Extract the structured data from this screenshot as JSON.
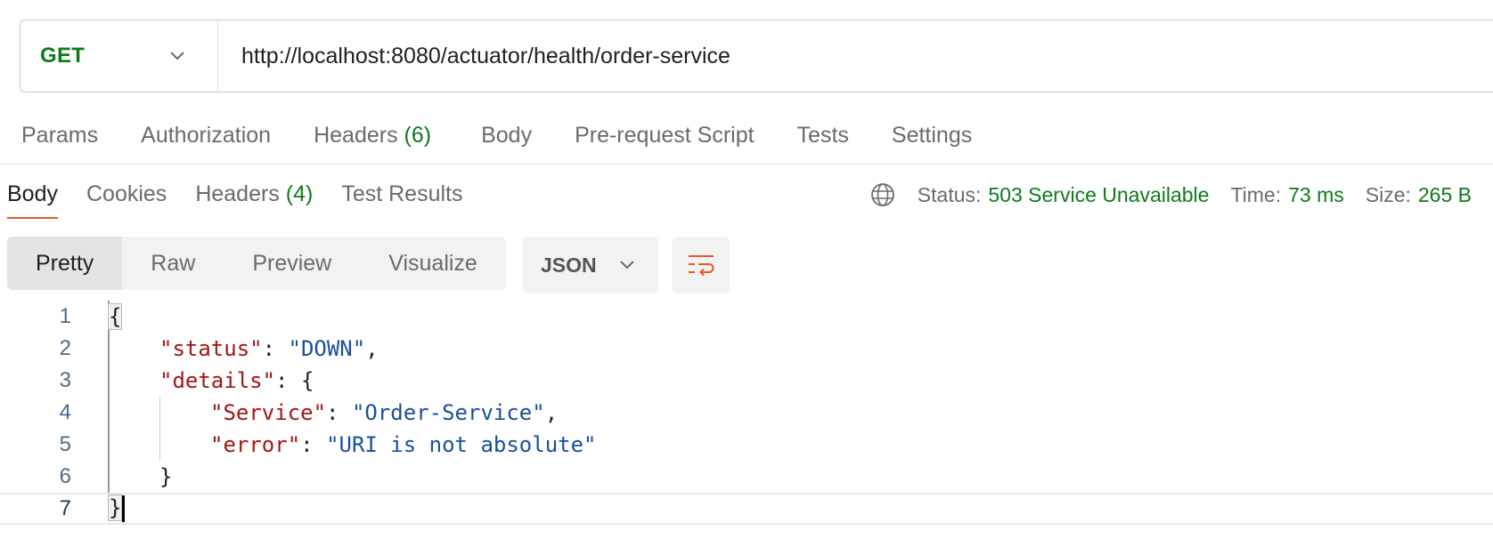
{
  "request": {
    "method": "GET",
    "url": "http://localhost:8080/actuator/health/order-service"
  },
  "request_tabs": {
    "params": "Params",
    "authorization": "Authorization",
    "headers_label": "Headers",
    "headers_count": "(6)",
    "body": "Body",
    "prerequest": "Pre-request Script",
    "tests": "Tests",
    "settings": "Settings"
  },
  "response_tabs": {
    "body": "Body",
    "cookies": "Cookies",
    "headers_label": "Headers",
    "headers_count": "(4)",
    "test_results": "Test Results"
  },
  "status": {
    "status_label": "Status:",
    "status_value": "503 Service Unavailable",
    "time_label": "Time:",
    "time_value": "73 ms",
    "size_label": "Size:",
    "size_value": "265 B",
    "icon": "globe-icon"
  },
  "view": {
    "modes": [
      "Pretty",
      "Raw",
      "Preview",
      "Visualize"
    ],
    "active_mode": "Pretty",
    "format": "JSON",
    "wrap_icon": "wrap-lines-icon"
  },
  "editor": {
    "line_numbers": [
      "1",
      "2",
      "3",
      "4",
      "5",
      "6",
      "7"
    ],
    "open_brace": "{",
    "close_brace": "}",
    "status_key": "\"status\"",
    "status_val": "\"DOWN\"",
    "details_key": "\"details\"",
    "service_key": "\"Service\"",
    "service_val": "\"Order-Service\"",
    "error_key": "\"error\"",
    "error_val": "\"URI is not absolute\"",
    "colon": ": ",
    "comma": ",",
    "colon_brace": ": {"
  },
  "colors": {
    "accent": "#e35a2b",
    "success": "#0f7a1b",
    "json_key": "#a31515",
    "json_string": "#1a4fa0"
  }
}
